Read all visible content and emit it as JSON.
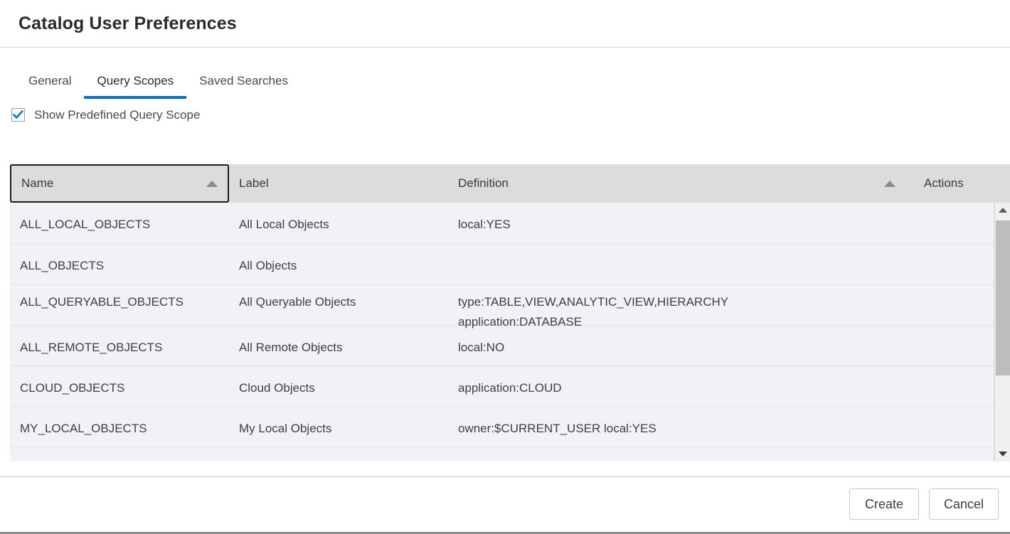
{
  "dialog": {
    "title": "Catalog User Preferences"
  },
  "tabs": [
    {
      "label": "General",
      "selected": false
    },
    {
      "label": "Query Scopes",
      "selected": true
    },
    {
      "label": "Saved Searches",
      "selected": false
    }
  ],
  "options": {
    "show_predefined": {
      "label": "Show Predefined Query Scope",
      "checked": true
    }
  },
  "table": {
    "columns": [
      {
        "label": "Name",
        "sorted": "asc",
        "focused": true
      },
      {
        "label": "Label",
        "sorted": "none",
        "focused": false
      },
      {
        "label": "Definition",
        "sorted": "asc",
        "focused": false
      },
      {
        "label": "Actions",
        "sorted": "none",
        "focused": false
      }
    ],
    "rows": [
      {
        "name": "ALL_LOCAL_OBJECTS",
        "label": "All Local Objects",
        "definition": "local:YES",
        "actions": ""
      },
      {
        "name": "ALL_OBJECTS",
        "label": "All Objects",
        "definition": "",
        "actions": ""
      },
      {
        "name": "ALL_QUERYABLE_OBJECTS",
        "label": "All Queryable Objects",
        "definition": "type:TABLE,VIEW,ANALYTIC_VIEW,HIERARCHY\napplication:DATABASE",
        "actions": ""
      },
      {
        "name": "ALL_REMOTE_OBJECTS",
        "label": "All Remote Objects",
        "definition": "local:NO",
        "actions": ""
      },
      {
        "name": "CLOUD_OBJECTS",
        "label": "Cloud Objects",
        "definition": "application:CLOUD",
        "actions": ""
      },
      {
        "name": "MY_LOCAL_OBJECTS",
        "label": "My Local Objects",
        "definition": "owner:$CURRENT_USER local:YES",
        "actions": ""
      },
      {
        "name": "",
        "label": "",
        "definition": "",
        "actions": ""
      }
    ]
  },
  "scrollbar": {
    "up_icon": "triangle-up-icon",
    "down_icon": "triangle-down-icon"
  },
  "footer": {
    "create_label": "Create",
    "cancel_label": "Cancel"
  },
  "colors": {
    "accent": "#0572ce",
    "header_bg": "#dcdcdc",
    "row_bg": "#f1f2f6",
    "focus_ring": "#1b1b1b"
  }
}
